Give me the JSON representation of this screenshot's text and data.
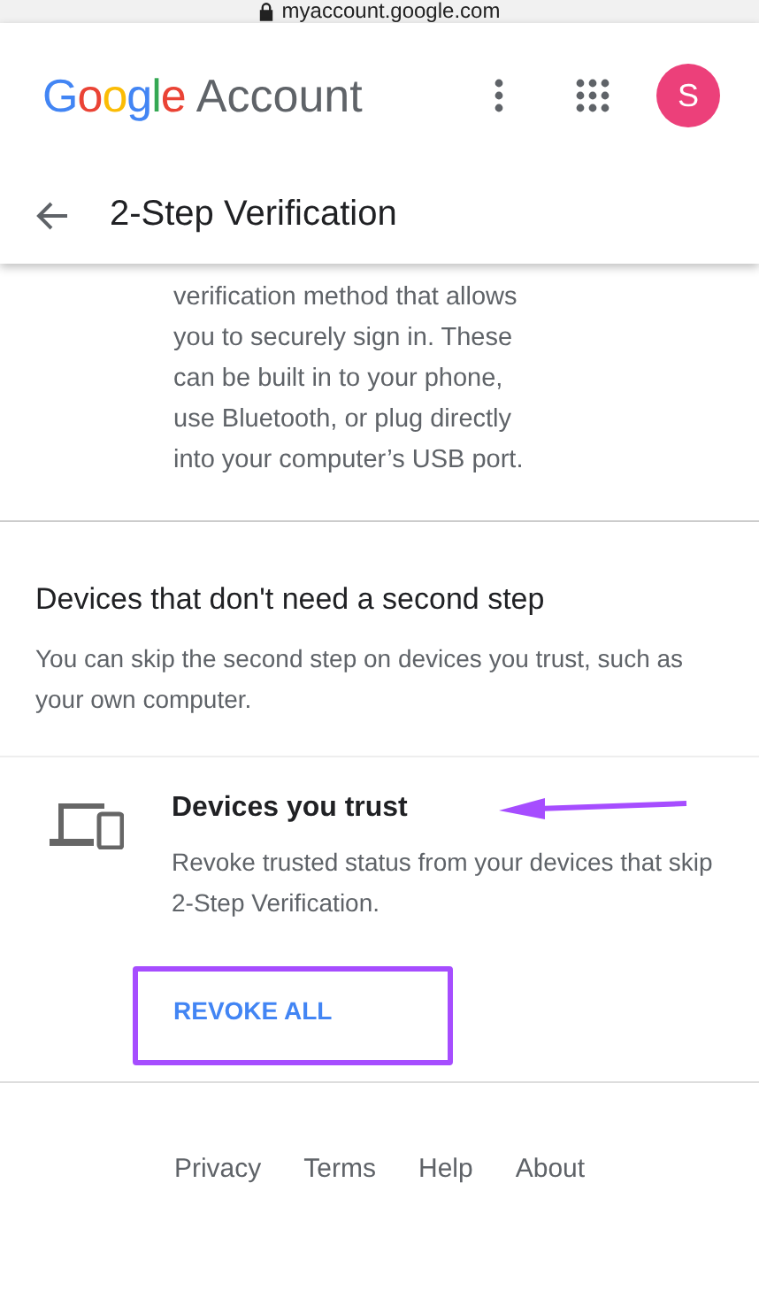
{
  "address_bar": {
    "url": "myaccount.google.com"
  },
  "header": {
    "logo": "Google",
    "product": "Account",
    "avatar": "S",
    "page_title": "2-Step Verification"
  },
  "security_key": {
    "description": "verification method that allows you to securely sign in. These can be built in to your phone, use Bluetooth, or plug directly into your computer’s USB port."
  },
  "trusted_devices": {
    "heading": "Devices that don't need a second step",
    "description": "You can skip the second step on devices you trust, such as your own computer.",
    "item_title": "Devices you trust",
    "item_description": "Revoke trusted status from your devices that skip 2-Step Verification.",
    "action": "REVOKE ALL"
  },
  "footer": [
    "Privacy",
    "Terms",
    "Help",
    "About"
  ]
}
